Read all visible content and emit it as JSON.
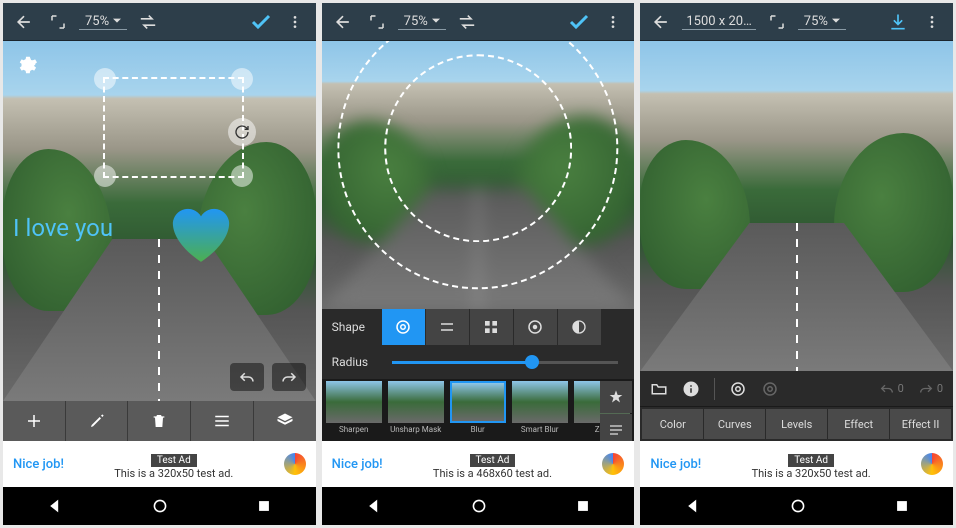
{
  "top": {
    "zoom": "75%",
    "dim": "1500 x 20…"
  },
  "s1": {
    "overlay_text": "I love you",
    "tools": [
      "add",
      "pencil",
      "trash",
      "list",
      "layers"
    ]
  },
  "s2": {
    "shape_label": "Shape",
    "radius_label": "Radius",
    "radius_pct": 62,
    "thumbs": [
      {
        "label": "Sharpen"
      },
      {
        "label": "Unsharp Mask"
      },
      {
        "label": "Blur"
      },
      {
        "label": "Smart Blur"
      },
      {
        "label": "Zoo"
      }
    ],
    "active_thumb": 2
  },
  "s3": {
    "tabs": [
      "Color",
      "Curves",
      "Levels",
      "Effect",
      "Effect II"
    ],
    "undo_count": "0",
    "redo_count": "0"
  },
  "ads": {
    "badge": "Test Ad",
    "nice": "Nice job!",
    "a1": "This is a 320x50 test ad.",
    "a2": "This is a 468x60 test ad.",
    "a3": "This is a 320x50 test ad."
  }
}
